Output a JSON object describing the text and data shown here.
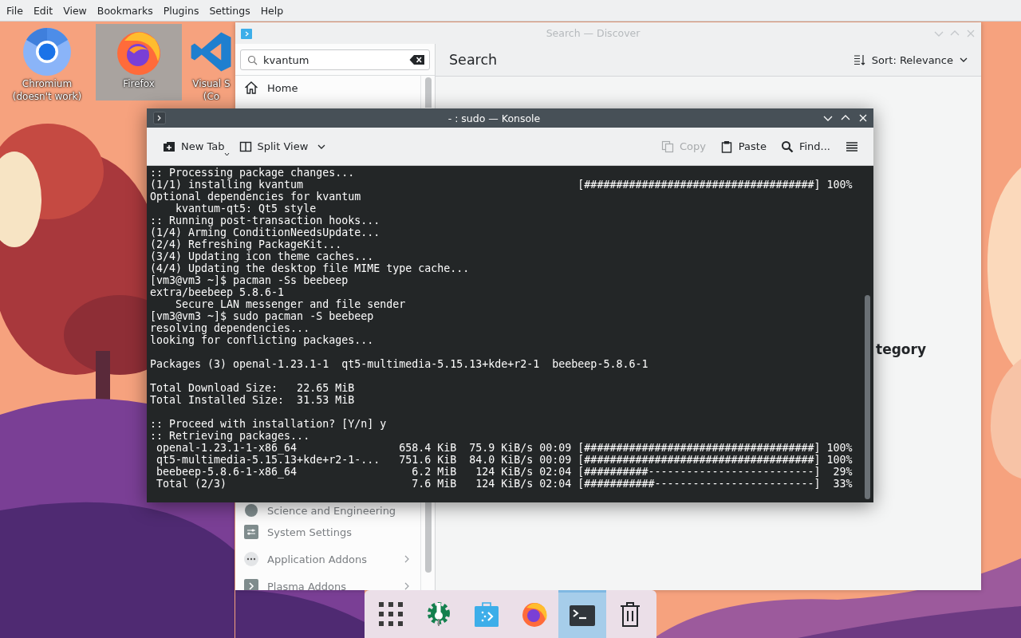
{
  "menu_bar": [
    "File",
    "Edit",
    "View",
    "Bookmarks",
    "Plugins",
    "Settings",
    "Help"
  ],
  "desktop_icons": [
    {
      "kind": "chromium",
      "label": [
        "Chromium",
        "(doesn't work)"
      ],
      "selected": false
    },
    {
      "kind": "firefox",
      "label": [
        "Firefox"
      ],
      "selected": true
    },
    {
      "kind": "vscode",
      "label": [
        "Visual S",
        "(Co"
      ],
      "selected": false
    }
  ],
  "discover": {
    "title": "Search — Discover",
    "search": {
      "value": "kvantum"
    },
    "page_title": "Search",
    "sort": "Sort: Relevance",
    "sidebar_top": [
      {
        "label": "Home",
        "kind": "home",
        "has_children": false
      }
    ],
    "sidebar_bottom": [
      {
        "label": "Science and Engineering",
        "kind": "science",
        "has_children": false
      },
      {
        "label": "System Settings",
        "kind": "settings",
        "has_children": false
      },
      {
        "label": "Application Addons",
        "kind": "addons",
        "has_children": true
      },
      {
        "label": "Plasma Addons",
        "kind": "plasma",
        "has_children": true
      }
    ],
    "partial_heading": "tegory"
  },
  "konsole": {
    "title": "- : sudo — Konsole",
    "toolbar": [
      {
        "label": "New Tab",
        "kind": "new-tab",
        "disabled": false
      },
      {
        "label": "Split View",
        "kind": "split-view",
        "disabled": false
      },
      {
        "label": "Copy",
        "kind": "copy",
        "disabled": true
      },
      {
        "label": "Paste",
        "kind": "paste",
        "disabled": false
      },
      {
        "label": "Find...",
        "kind": "find",
        "disabled": false
      }
    ],
    "output_blocks": [
      [
        ":: Processing package changes...",
        "(1/1) installing kvantum                                           [####################################] 100%",
        "Optional dependencies for kvantum",
        "    kvantum-qt5: Qt5 style",
        ":: Running post-transaction hooks...",
        "(1/4) Arming ConditionNeedsUpdate...",
        "(2/4) Refreshing PackageKit...",
        "(3/4) Updating icon theme caches...",
        "(4/4) Updating the desktop file MIME type cache...",
        "[vm3@vm3 ~]$ pacman -Ss beebeep",
        "extra/beebeep 5.8.6-1",
        "    Secure LAN messenger and file sender",
        "[vm3@vm3 ~]$ sudo pacman -S beebeep",
        "resolving dependencies...",
        "looking for conflicting packages..."
      ],
      [
        "Packages (3) openal-1.23.1-1  qt5-multimedia-5.15.13+kde+r2-1  beebeep-5.8.6-1"
      ],
      [
        "Total Download Size:   22.65 MiB",
        "Total Installed Size:  31.53 MiB"
      ],
      [
        ":: Proceed with installation? [Y/n] y",
        ":: Retrieving packages...",
        " openal-1.23.1-1-x86_64                658.4 KiB  75.9 KiB/s 00:09 [####################################] 100%",
        " qt5-multimedia-5.15.13+kde+r2-1-...   751.6 KiB  84.0 KiB/s 00:09 [####################################] 100%",
        " beebeep-5.8.6-1-x86_64                  6.2 MiB   124 KiB/s 02:04 [##########--------------------------]  29%",
        " Total (2/3)                             7.6 MiB   124 KiB/s 02:04 [###########-------------------------]  33%"
      ]
    ]
  },
  "taskbar": [
    {
      "kind": "apps",
      "selected": false
    },
    {
      "kind": "gear",
      "selected": false
    },
    {
      "kind": "store",
      "selected": false
    },
    {
      "kind": "browser",
      "selected": false
    },
    {
      "kind": "terminal",
      "selected": true
    },
    {
      "kind": "trash",
      "selected": false
    }
  ]
}
